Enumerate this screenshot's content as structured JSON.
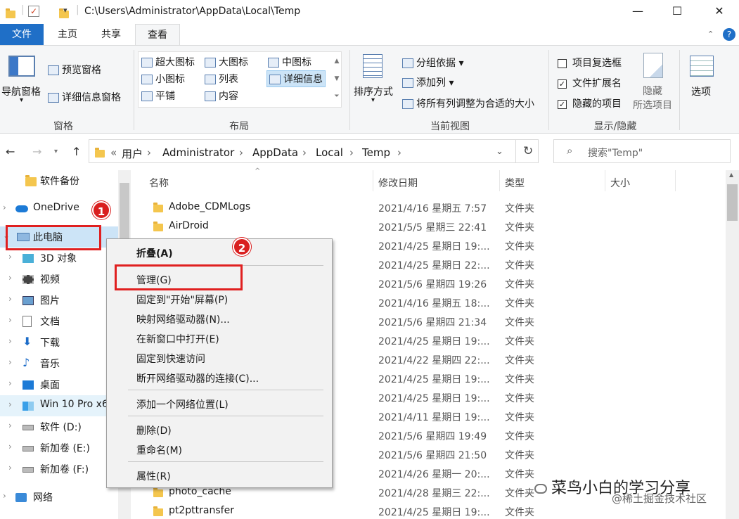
{
  "title_bar": {
    "path": "C:\\Users\\Administrator\\AppData\\Local\\Temp",
    "minimize": "—",
    "maximize": "☐",
    "close": "✕"
  },
  "ribbon_tabs": [
    "文件",
    "主页",
    "共享",
    "查看"
  ],
  "ribbon": {
    "panes": {
      "nav_pane": "导航窗格",
      "preview_pane": "预览窗格",
      "details_pane": "详细信息窗格",
      "label": "窗格"
    },
    "layout": {
      "items": [
        "超大图标",
        "大图标",
        "中图标",
        "小图标",
        "列表",
        "详细信息",
        "平铺",
        "内容"
      ],
      "label": "布局"
    },
    "current_view": {
      "sort_by": "排序方式",
      "group_by": "分组依据",
      "add_column": "添加列",
      "fit_columns": "将所有列调整为合适的大小",
      "label": "当前视图"
    },
    "show_hide": {
      "item_checkboxes": "项目复选框",
      "file_extensions": "文件扩展名",
      "hidden_items": "隐藏的项目",
      "hide_selected_1": "隐藏",
      "hide_selected_2": "所选项目",
      "label": "显示/隐藏"
    },
    "options": "选项"
  },
  "address": {
    "prefix": "«",
    "crumbs": [
      "用户",
      "Administrator",
      "AppData",
      "Local",
      "Temp"
    ],
    "search_placeholder": "搜索\"Temp\""
  },
  "nav_pane": [
    {
      "label": "软件备份",
      "icon": "folder"
    },
    {
      "label": "OneDrive",
      "icon": "cloud"
    },
    {
      "label": "此电脑",
      "icon": "computer"
    },
    {
      "label": "3D 对象",
      "icon": "cube"
    },
    {
      "label": "视频",
      "icon": "film"
    },
    {
      "label": "图片",
      "icon": "picture"
    },
    {
      "label": "文档",
      "icon": "document"
    },
    {
      "label": "下载",
      "icon": "download"
    },
    {
      "label": "音乐",
      "icon": "music"
    },
    {
      "label": "桌面",
      "icon": "desktop"
    },
    {
      "label": "Win 10 Pro x6",
      "icon": "drive-windows"
    },
    {
      "label": "软件 (D:)",
      "icon": "drive"
    },
    {
      "label": "新加卷 (E:)",
      "icon": "drive"
    },
    {
      "label": "新加卷 (F:)",
      "icon": "drive"
    },
    {
      "label": "网络",
      "icon": "network"
    }
  ],
  "file_list": {
    "columns": [
      "名称",
      "修改日期",
      "类型",
      "大小"
    ],
    "rows": [
      {
        "name": "Adobe_CDMLogs",
        "date": "2021/4/16 星期五 7:57",
        "type": "文件夹"
      },
      {
        "name": "AirDroid",
        "date": "2021/5/5 星期三 22:41",
        "type": "文件夹"
      },
      {
        "name": "",
        "date": "2021/4/25 星期日 19:...",
        "type": "文件夹"
      },
      {
        "name": "",
        "date": "2021/4/25 星期日 22:...",
        "type": "文件夹"
      },
      {
        "name": "",
        "date": "2021/5/6 星期四 19:26",
        "type": "文件夹"
      },
      {
        "name": "",
        "date": "2021/4/16 星期五 18:...",
        "type": "文件夹"
      },
      {
        "name": "",
        "date": "2021/5/6 星期四 21:34",
        "type": "文件夹"
      },
      {
        "name": "",
        "date": "2021/4/25 星期日 19:...",
        "type": "文件夹"
      },
      {
        "name": "",
        "date": "2021/4/22 星期四 22:...",
        "type": "文件夹"
      },
      {
        "name": "",
        "date": "2021/4/25 星期日 19:...",
        "type": "文件夹"
      },
      {
        "name": "",
        "date": "2021/4/25 星期日 19:...",
        "type": "文件夹"
      },
      {
        "name": "",
        "date": "2021/4/11 星期日 19:...",
        "type": "文件夹"
      },
      {
        "name": "",
        "date": "2021/5/6 星期四 19:49",
        "type": "文件夹"
      },
      {
        "name": "",
        "date": "2021/5/6 星期四 21:50",
        "type": "文件夹"
      },
      {
        "name": "",
        "date": "2021/4/26 星期一 20:...",
        "type": "文件夹"
      },
      {
        "name": "photo_cache",
        "date": "2021/4/28 星期三 22:...",
        "type": "文件夹"
      },
      {
        "name": "pt2pttransfer",
        "date": "2021/4/25 星期日 19:...",
        "type": "文件夹"
      }
    ]
  },
  "context_menu": {
    "items": [
      "折叠(A)",
      "管理(G)",
      "固定到\"开始\"屏幕(P)",
      "映射网络驱动器(N)...",
      "在新窗口中打开(E)",
      "固定到快速访问",
      "断开网络驱动器的连接(C)...",
      "添加一个网络位置(L)",
      "删除(D)",
      "重命名(M)",
      "属性(R)"
    ]
  },
  "annotations": {
    "badge1": "1",
    "badge2": "2"
  },
  "watermark": {
    "main": "菜鸟小白的学习分享",
    "sub": "@稀土掘金技术社区"
  },
  "colors": {
    "file_tab": "#1f6fc7",
    "highlight_red": "#e02020",
    "selection": "#cce4f7"
  }
}
